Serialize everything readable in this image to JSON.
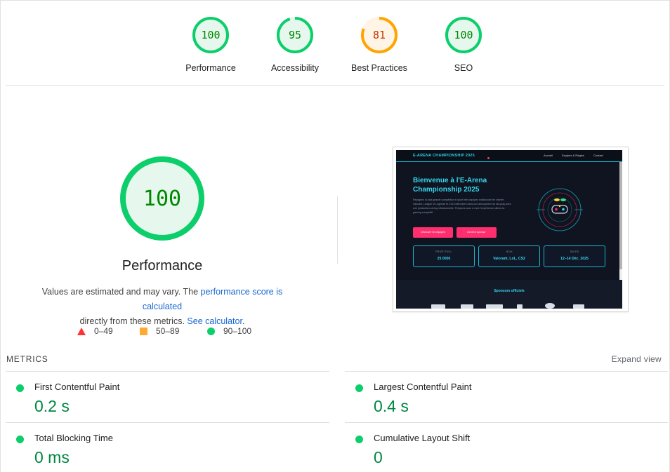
{
  "summary": {
    "gauges": [
      {
        "score": "100",
        "label": "Performance",
        "color": "#0cce6b",
        "fill": "#e6f7ee",
        "text_color": "#008800",
        "fraction": 1.0
      },
      {
        "score": "95",
        "label": "Accessibility",
        "color": "#0cce6b",
        "fill": "#e6f7ee",
        "text_color": "#008800",
        "fraction": 0.95
      },
      {
        "score": "81",
        "label": "Best Practices",
        "color": "#ffa400",
        "fill": "#fff4e5",
        "text_color": "#c33300",
        "fraction": 0.81
      },
      {
        "score": "100",
        "label": "SEO",
        "color": "#0cce6b",
        "fill": "#e6f7ee",
        "text_color": "#008800",
        "fraction": 1.0
      }
    ]
  },
  "category": {
    "score": "100",
    "title": "Performance",
    "desc_prefix": "Values are estimated and may vary. The ",
    "link_score": "performance score is calculated",
    "desc_middle": " directly from these metrics. ",
    "link_calc": "See calculator",
    "desc_suffix": ".",
    "legend": [
      {
        "range": "0–49",
        "shape": "triangle",
        "color": "#ff3333"
      },
      {
        "range": "50–89",
        "shape": "square",
        "color": "#ffaa33"
      },
      {
        "range": "90–100",
        "shape": "circle",
        "color": "#0cce6b"
      }
    ]
  },
  "screenshot": {
    "brand": "E-ARENA CHAMPIONSHIP 2025",
    "nav": [
      "Accueil",
      "Equipes & Règles",
      "Contact"
    ],
    "heading": "Bienvenue à l'E-Arena Championship 2025",
    "paragraph": "Rejoignez la plus grande compétition e-sport inter-équipes multiculuiré de l'année. Valorant, League of Legends et CS2 s'affrontent dans une atmosphère de fair-play avec une production semi-professionnelle. Préparez-vous à vivre l'expérience ultime du gaming compétitif.",
    "buttons": [
      "Découvrir les équipes",
      "Devenir sponsor"
    ],
    "stats": [
      {
        "key": "PRIZE POOL",
        "value": "25 000€"
      },
      {
        "key": "JEUX",
        "value": "Valorant, LoL, CS2"
      },
      {
        "key": "DATES",
        "value": "12–14 Déc. 2025"
      }
    ],
    "sponsors": "Sponsors officiels"
  },
  "metrics": {
    "heading": "METRICS",
    "expand": "Expand view",
    "items": [
      {
        "name": "First Contentful Paint",
        "value": "0.2 s"
      },
      {
        "name": "Largest Contentful Paint",
        "value": "0.4 s"
      },
      {
        "name": "Total Blocking Time",
        "value": "0 ms"
      },
      {
        "name": "Cumulative Layout Shift",
        "value": "0"
      }
    ]
  }
}
